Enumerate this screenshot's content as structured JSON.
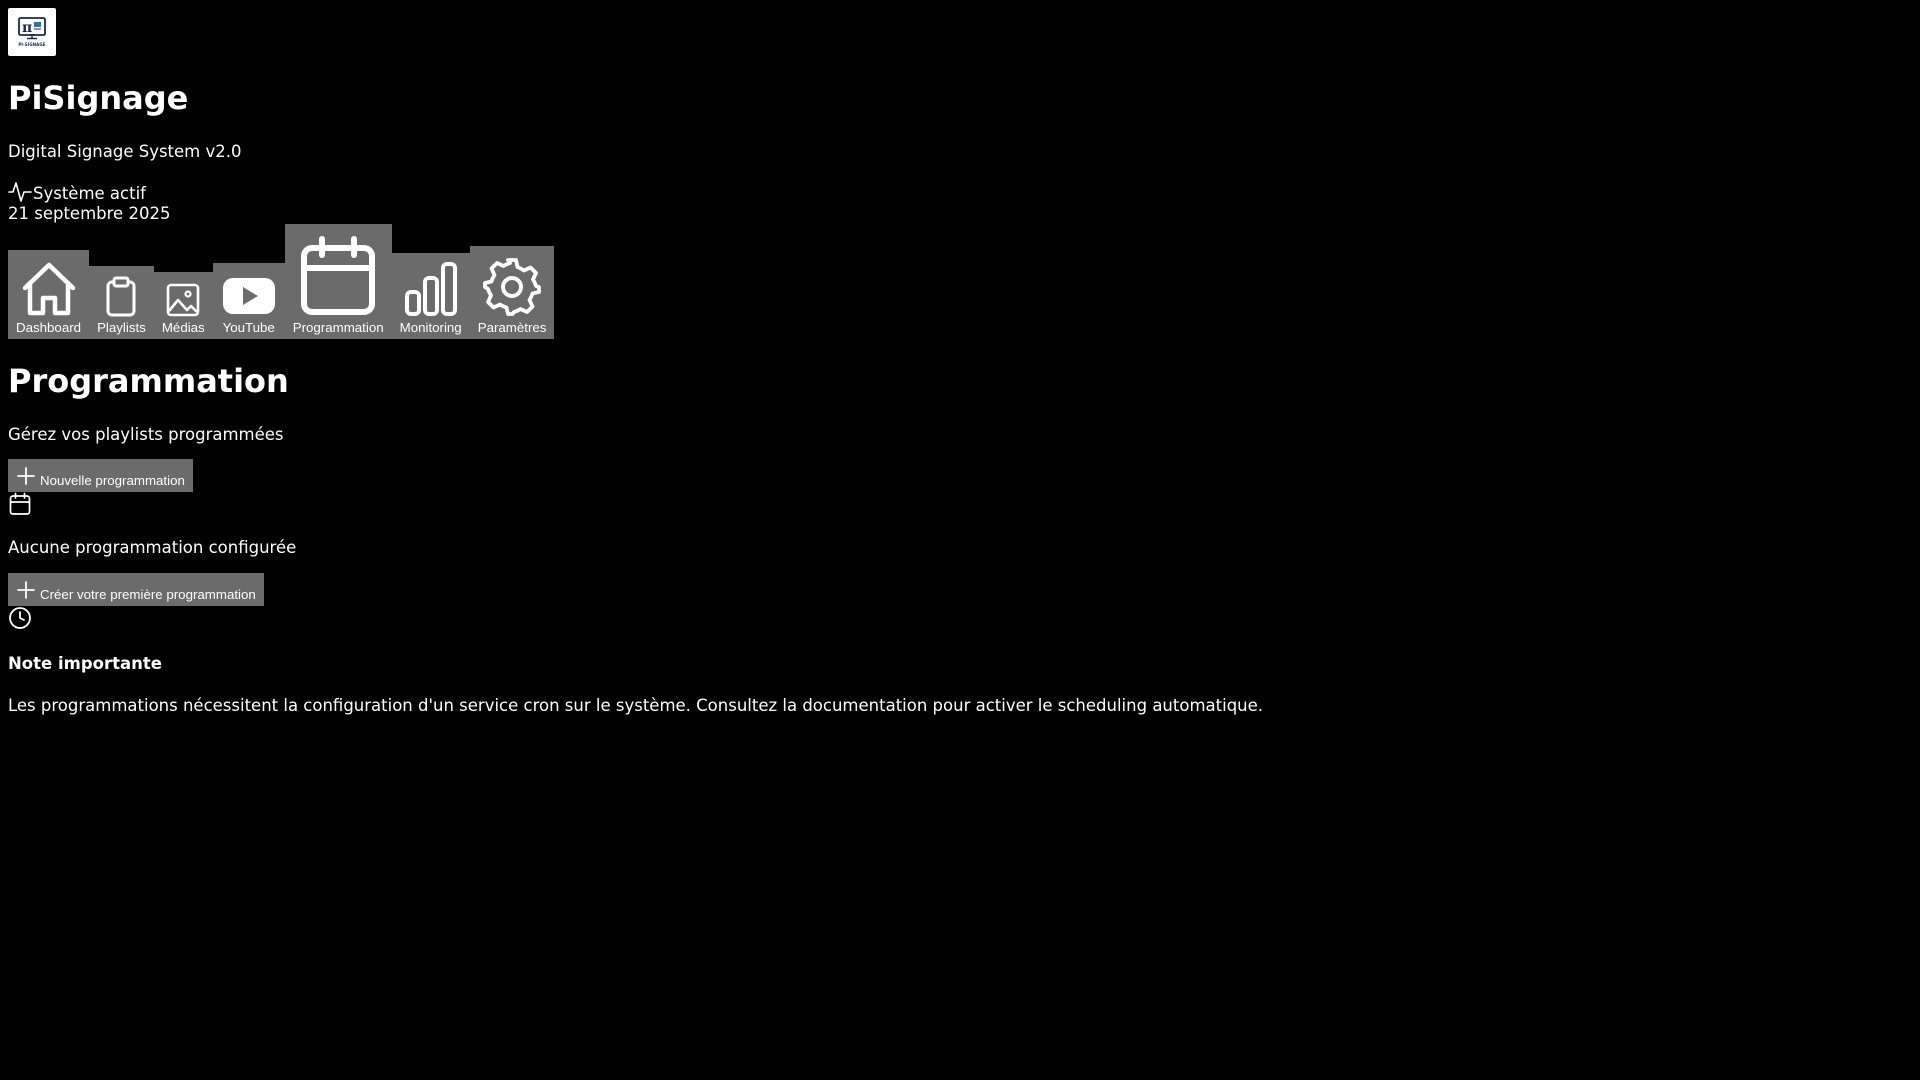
{
  "header": {
    "logo_text": "PI-SIGNAGE",
    "app_title": "PiSignage",
    "subtitle": "Digital Signage System v2.0",
    "status": "Système actif",
    "date": "21 septembre 2025"
  },
  "nav": {
    "items": [
      {
        "label": "Dashboard",
        "icon": "home-icon"
      },
      {
        "label": "Playlists",
        "icon": "clipboard-icon"
      },
      {
        "label": "Médias",
        "icon": "image-icon"
      },
      {
        "label": "YouTube",
        "icon": "youtube-icon"
      },
      {
        "label": "Programmation",
        "icon": "calendar-icon",
        "active": true
      },
      {
        "label": "Monitoring",
        "icon": "bar-chart-icon"
      },
      {
        "label": "Paramètres",
        "icon": "gear-icon"
      }
    ]
  },
  "main": {
    "title": "Programmation",
    "subtitle": "Gérez vos playlists programmées",
    "new_button": "Nouvelle programmation",
    "empty_text": "Aucune programmation configurée",
    "create_first_button": "Créer votre première programmation",
    "note_title": "Note importante",
    "note_text": "Les programmations nécessitent la configuration d'un service cron sur le système. Consultez la documentation pour activer le scheduling automatique."
  },
  "colors": {
    "background": "#000000",
    "text": "#ffffff",
    "button_bg": "#6b6b6b"
  }
}
